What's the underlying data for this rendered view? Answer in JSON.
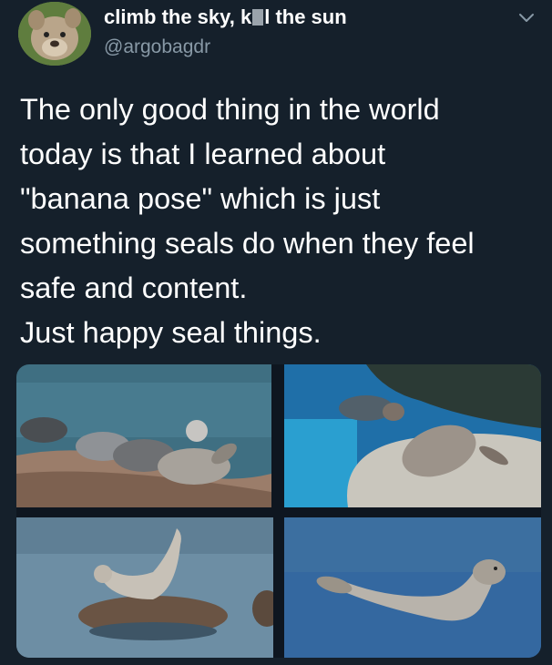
{
  "tweet": {
    "display_name_prefix": "climb the sky, k",
    "display_name_suffix": "l the sun",
    "handle": "@argobagdr",
    "text_lines": [
      "The only good thing in the world",
      "today is that I learned about",
      "\"banana pose\" which is just",
      "something seals do when they feel",
      "safe and content.",
      "Just happy seal things."
    ]
  },
  "icons": {
    "menu": "chevron-down-icon",
    "avatar": "dog-avatar"
  },
  "colors": {
    "background": "#15202b",
    "text": "#ffffff",
    "secondary_text": "#8899a6"
  },
  "media": {
    "photo_count": 4
  }
}
